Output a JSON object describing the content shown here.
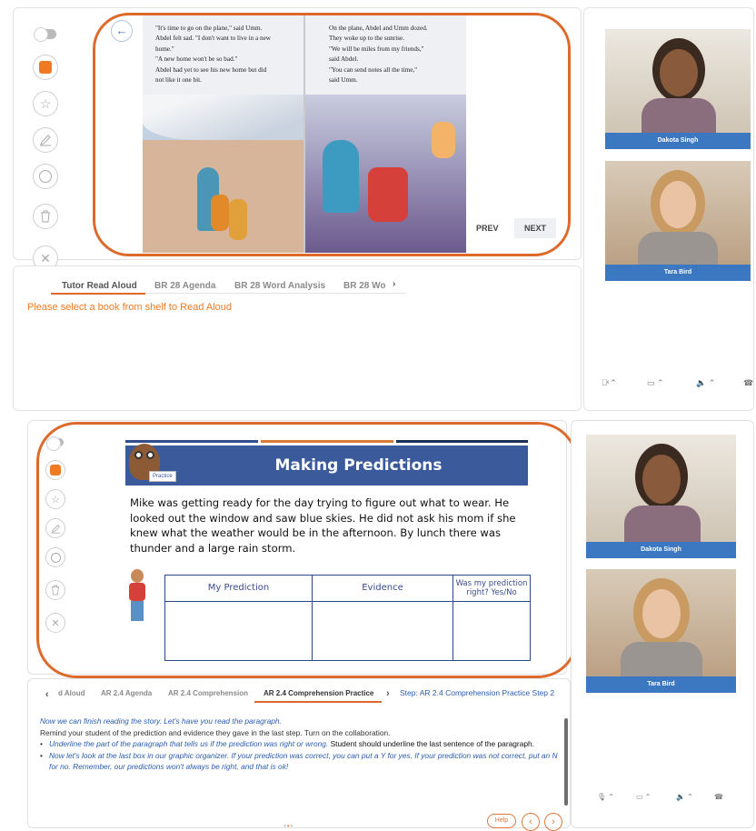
{
  "top": {
    "book": {
      "left_page_lines": [
        "\"It's time to go on the plane,\" said Umm.",
        "Abdel felt sad. \"I don't want to live in a new",
        "home.\"",
        "\"A new home won't be so bad.\"",
        "Abdel had yet to see his new home but did",
        "not like it one bit."
      ],
      "right_page_lines": [
        "On the plane, Abdel and Umm dozed.",
        "They woke up to the sunrise.",
        "\"We will be miles from my friends,\"",
        "said Abdel.",
        "\"You can send notes all the time,\"",
        "said Umm."
      ],
      "prev_label": "PREV",
      "next_label": "NEXT"
    },
    "tabs": [
      "Tutor Read Aloud",
      "BR 28 Agenda",
      "BR 28 Word Analysis",
      "BR 28 Wo"
    ],
    "message": "Please select a book from shelf to Read Aloud",
    "participants": [
      "Dakota Singh",
      "Tara Bird"
    ]
  },
  "bottom": {
    "slide": {
      "title": "Making Predictions",
      "badge": "Practice",
      "paragraph": "Mike was getting ready for the day trying to figure out what to wear. He looked out the window and saw blue skies.  He did not ask his mom if she knew what the weather would be in the afternoon. By lunch there was thunder and a large rain storm.",
      "columns": [
        "My Prediction",
        "Evidence",
        "Was my prediction right? Yes/No"
      ]
    },
    "tabs": [
      "d Aloud",
      "AR 2.4 Agenda",
      "AR 2.4 Comprehension",
      "AR 2.4 Comprehension Practice"
    ],
    "step_label": "Step: AR 2.4 Comprehension Practice Step 2",
    "script": {
      "line1": "Now we can finish reading the story. Let's have you read the paragraph.",
      "line2": "Remind your student of the prediction and evidence they gave in the last step. Turn on the collaboration.",
      "bullet1_italic": "Underline the part of the paragraph that tells us if the prediction was right or wrong.",
      "bullet1_plain": " Student should underline the last sentence of the paragraph.",
      "bullet2_italic": "Now let's look at the last box in our graphic organizer. If your prediction was correct, you can put a Y for yes. If your prediction was not correct, put an N for no. Remember, our predictions won't always be right, and that is ok!"
    },
    "help_label": "Help",
    "participants": [
      "Dakota Singh",
      "Tara Bird"
    ]
  },
  "colors": {
    "accent": "#dd6a2b",
    "name_bar": "#3c78c2",
    "slide_header": "#3a5a9c",
    "script_blue": "#2a5db0",
    "message_orange": "#f07a22"
  }
}
